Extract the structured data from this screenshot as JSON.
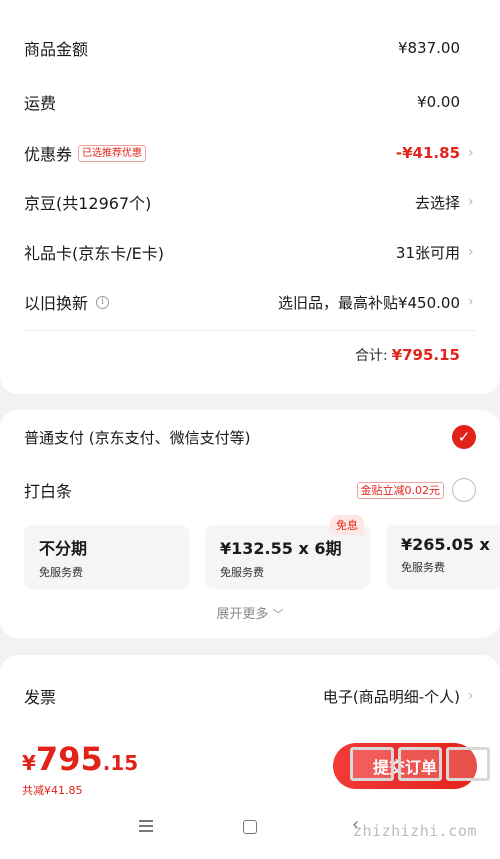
{
  "summary": {
    "goods_amount": {
      "label": "商品金额",
      "value": "¥837.00"
    },
    "shipping": {
      "label": "运费",
      "value": "¥0.00"
    },
    "coupon": {
      "label": "优惠券",
      "tag": "已选推荐优惠",
      "value": "-¥41.85"
    },
    "jingdou": {
      "label": "京豆(共12967个)",
      "value": "去选择"
    },
    "gift_card": {
      "label": "礼品卡(京东卡/E卡)",
      "value": "31张可用"
    },
    "trade_in": {
      "label": "以旧换新",
      "value": "选旧品，最高补贴¥450.00"
    },
    "total": {
      "label": "合计:",
      "value": "¥795.15"
    }
  },
  "payment": {
    "normal": {
      "label": "普通支付 (京东支付、微信支付等)",
      "selected": true
    },
    "baitiao": {
      "label": "打白条",
      "tag": "金贴立减0.02元",
      "selected": false
    },
    "plans": [
      {
        "title": "不分期",
        "sub": "免服务费",
        "badge": ""
      },
      {
        "title": "¥132.55 x 6期",
        "sub": "免服务费",
        "badge": "免息"
      },
      {
        "title": "¥265.05 x",
        "sub": "免服务费",
        "badge": ""
      }
    ],
    "expand_more": "展开更多"
  },
  "invoice": {
    "label": "发票",
    "value": "电子(商品明细-个人)"
  },
  "footer": {
    "currency": "¥",
    "price_int": "795",
    "price_dec": ".15",
    "saved": "共减¥41.85",
    "submit": "提交订单"
  },
  "watermark": "zhizhizhi.com",
  "icons": {
    "chevron": "chevron-right-icon",
    "info": "info-icon",
    "check": "checkmark-icon",
    "menu": "menu-icon",
    "home": "home-icon",
    "back": "back-icon"
  },
  "colors": {
    "accent": "#e2231a",
    "background": "#f2f2f2"
  }
}
